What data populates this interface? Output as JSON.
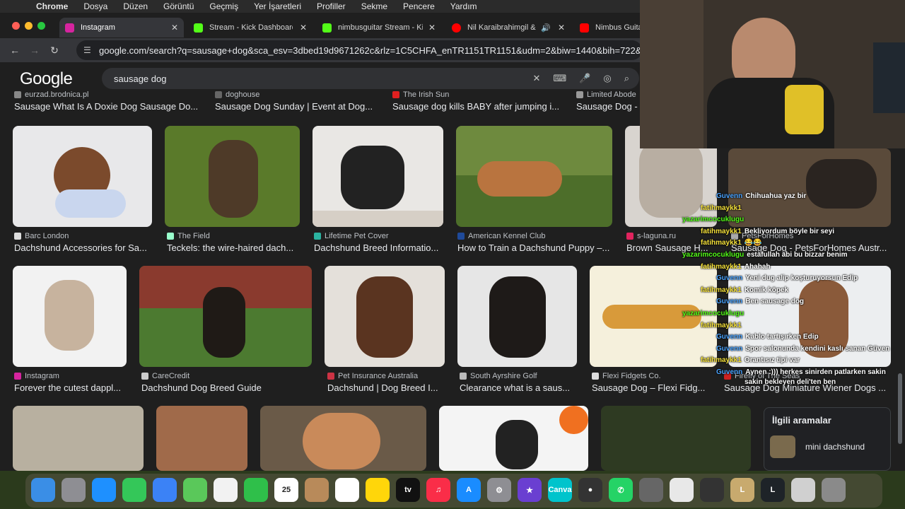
{
  "menubar": {
    "app": "Chrome",
    "items": [
      "Dosya",
      "Düzen",
      "Görüntü",
      "Geçmiş",
      "Yer İşaretleri",
      "Profiller",
      "Sekme",
      "Pencere",
      "Yardım"
    ]
  },
  "tabs": [
    {
      "title": "Instagram",
      "color": "#d6249f"
    },
    {
      "title": "Stream - Kick Dashboard",
      "color": "#53fc18"
    },
    {
      "title": "nimbusguitar Stream - Kick",
      "color": "#53fc18"
    },
    {
      "title": "Nil Karaibrahimgil &",
      "color": "#ff0000"
    },
    {
      "title": "Nimbus Guita",
      "color": "#ff0000"
    }
  ],
  "toolbar": {
    "url": "google.com/search?q=sausage+dog&sca_esv=3dbed19d9671262c&rlz=1C5CHFA_enTR1151TR1151&udm=2&biw=1440&bih=722&"
  },
  "search": {
    "logo": "Google",
    "query": "sausage dog"
  },
  "row0": [
    {
      "source": "eurzad.brodnica.pl",
      "caption": "Sausage What Is A Doxie Dog Sausage Do..."
    },
    {
      "source": "doghouse",
      "caption": "Sausage Dog Sunday | Event at Dog..."
    },
    {
      "source": "The Irish Sun",
      "caption": "Sausage dog kills BABY after jumping i..."
    },
    {
      "source": "Limited Abode",
      "caption": "Sausage Dog -"
    }
  ],
  "row1": [
    {
      "source": "Barc London",
      "caption": "Dachshund Accessories for Sa..."
    },
    {
      "source": "The Field",
      "caption": "Teckels: the wire-haired dach..."
    },
    {
      "source": "Lifetime Pet Cover",
      "caption": "Dachshund Breed Informatio..."
    },
    {
      "source": "American Kennel Club",
      "caption": "How to Train a Dachshund Puppy –..."
    },
    {
      "source": "s-laguna.ru",
      "caption": "Brown Sausage H..."
    },
    {
      "source": "PetsForHomes",
      "caption": "Sausage Dog - PetsForHomes Austr..."
    }
  ],
  "row2": [
    {
      "source": "Instagram",
      "caption": "Forever the cutest dappl..."
    },
    {
      "source": "CareCredit",
      "caption": "Dachshund Dog Breed Guide"
    },
    {
      "source": "Pet Insurance Australia",
      "caption": "Dachshund | Dog Breed I..."
    },
    {
      "source": "South Ayrshire Golf",
      "caption": "Clearance what is a saus..."
    },
    {
      "source": "Flexi Fidgets Co.",
      "caption": "Sausage Dog – Flexi Fidg..."
    },
    {
      "source": "Firefly of The Seas",
      "caption": "Sausage Dog Miniature Wiener Dogs ..."
    }
  ],
  "related": {
    "heading": "İlgili aramalar",
    "items": [
      "mini dachshund"
    ]
  },
  "chat": [
    {
      "user": "Guvenn",
      "msg": "Chihuahua yaz bir",
      "ucolor": "#4aa3ff"
    },
    {
      "user": "fatihmaykk1",
      "msg": "",
      "ucolor": "#f5e13a"
    },
    {
      "user": "yazarimcocuklugu",
      "msg": "",
      "ucolor": "#53fc18"
    },
    {
      "user": "fatihmaykk1",
      "msg": "Bekliyordum böyle bir seyi",
      "ucolor": "#f5e13a"
    },
    {
      "user": "fatihmaykk1",
      "msg": "😂😂",
      "ucolor": "#f5e13a"
    },
    {
      "user": "yazarimcocuklugu",
      "msg": "estafullah abi bu bizzar benim",
      "ucolor": "#53fc18"
    },
    {
      "user": "fatihmaykk1",
      "msg": "Ahahah",
      "ucolor": "#f5e13a"
    },
    {
      "user": "Guvenn",
      "msg": "Yeni dug alip koşturuyorsun Edip",
      "ucolor": "#4aa3ff"
    },
    {
      "user": "fatihmaykk1",
      "msg": "Komik köpek",
      "ucolor": "#f5e13a"
    },
    {
      "user": "Guvenn",
      "msg": "Ben sausage dog",
      "ucolor": "#4aa3ff"
    },
    {
      "user": "yazarimcocuklugu",
      "msg": "",
      "ucolor": "#53fc18"
    },
    {
      "user": "fatihmaykk1",
      "msg": "",
      "ucolor": "#f5e13a"
    },
    {
      "user": "Guvenn",
      "msg": "Kablo tartışırken Edip",
      "ucolor": "#4aa3ff"
    },
    {
      "user": "Guvenn",
      "msg": "Spor salonunda kendini kaslı sanan Güven",
      "ucolor": "#4aa3ff"
    },
    {
      "user": "fatihmaykk1",
      "msg": "Orantısız tipi var",
      "ucolor": "#f5e13a"
    },
    {
      "user": "Guvenn",
      "msg": "Aynen :))) herkes sinirden patlarken sakin",
      "ucolor": "#4aa3ff"
    },
    {
      "user": "",
      "msg": "sakin bekleyen deli'ten ben",
      "ucolor": "#4aa3ff"
    }
  ],
  "dock": [
    {
      "name": "finder-icon",
      "color": "#3a8ee6",
      "label": ""
    },
    {
      "name": "launchpad-icon",
      "color": "#8e8e93",
      "label": ""
    },
    {
      "name": "safari-icon",
      "color": "#1e90ff",
      "label": ""
    },
    {
      "name": "messages-icon",
      "color": "#34c759",
      "label": ""
    },
    {
      "name": "mail-icon",
      "color": "#3b82f6",
      "label": ""
    },
    {
      "name": "maps-icon",
      "color": "#5ac85a",
      "label": ""
    },
    {
      "name": "photos-icon",
      "color": "#f2f2f2",
      "label": ""
    },
    {
      "name": "facetime-icon",
      "color": "#2fbf4a",
      "label": ""
    },
    {
      "name": "calendar-icon",
      "color": "#ffffff",
      "label": "25"
    },
    {
      "name": "contacts-icon",
      "color": "#b88a5a",
      "label": ""
    },
    {
      "name": "reminders-icon",
      "color": "#ffffff",
      "label": ""
    },
    {
      "name": "notes-icon",
      "color": "#ffd60a",
      "label": ""
    },
    {
      "name": "appletv-icon",
      "color": "#111111",
      "label": "tv"
    },
    {
      "name": "music-icon",
      "color": "#fa2d48",
      "label": "♫"
    },
    {
      "name": "appstore-icon",
      "color": "#1a8cff",
      "label": "A"
    },
    {
      "name": "settings-icon",
      "color": "#8e8e93",
      "label": "⚙"
    },
    {
      "name": "imovie-icon",
      "color": "#6a3fd1",
      "label": "★"
    },
    {
      "name": "canva-icon",
      "color": "#00c4cc",
      "label": "Canva"
    },
    {
      "name": "obs-icon",
      "color": "#333333",
      "label": "●"
    },
    {
      "name": "whatsapp-icon",
      "color": "#25d366",
      "label": "✆"
    },
    {
      "name": "utility-icon",
      "color": "#666666",
      "label": ""
    },
    {
      "name": "chrome-icon",
      "color": "#e8e8e8",
      "label": ""
    },
    {
      "name": "calculator-icon",
      "color": "#333333",
      "label": ""
    },
    {
      "name": "league-icon",
      "color": "#c8aa6e",
      "label": "L"
    },
    {
      "name": "league-client-icon",
      "color": "#1e2328",
      "label": "L"
    },
    {
      "name": "preview-icon",
      "color": "#d0d0d0",
      "label": ""
    },
    {
      "name": "trash-icon",
      "color": "#8a8a8a",
      "label": ""
    }
  ]
}
